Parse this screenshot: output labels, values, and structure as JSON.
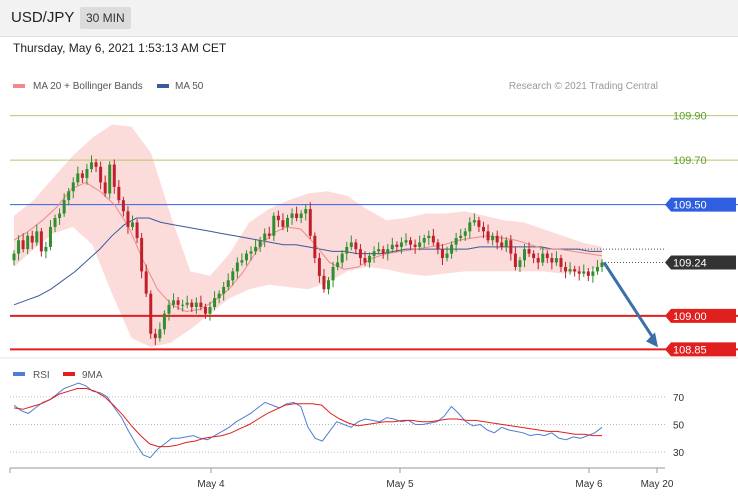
{
  "header": {
    "symbol": "USD/JPY",
    "timeframe": "30 MIN",
    "timestamp": "Thursday, May 6, 2021 1:53:13 AM CET"
  },
  "credit": "Research © 2021 Trading Central",
  "colors": {
    "up_candle": "#2f8f2f",
    "down_candle": "#c0202a",
    "ma20": "#ee8a8a",
    "bands_fill": "#fbd5d5",
    "ma50": "#3a5a9a",
    "support": "#e01f1f",
    "pivot": "#2f5fe0",
    "resistance_thin": "#b8c86a",
    "arrow": "#3b6fa8",
    "rsi": "#4f7fd0",
    "rsi_ma": "#e01f1f"
  },
  "chart_data": [
    {
      "type": "candlestick",
      "title": "USD/JPY",
      "ylim": [
        108.82,
        109.97
      ],
      "x_ticks": [
        "May 4",
        "May 5",
        "May 6",
        "May 20"
      ],
      "legend": [
        {
          "label": "MA 20 + Bollinger Bands",
          "color": "#ee8a8a"
        },
        {
          "label": "MA 50",
          "color": "#3a5a9a"
        }
      ],
      "levels": [
        {
          "value": 109.9,
          "label": "109.90",
          "kind": "resistance",
          "color": "#b8c86a",
          "label_color": "#5aa02a"
        },
        {
          "value": 109.7,
          "label": "109.70",
          "kind": "resistance",
          "color": "#b8c86a",
          "label_color": "#5aa02a"
        },
        {
          "value": 109.5,
          "label": "109.50",
          "kind": "pivot",
          "color": "#2f5fe0",
          "label_color": "#ffffff"
        },
        {
          "value": 109.24,
          "label": "109.24",
          "kind": "last",
          "color": "#333333",
          "label_color": "#ffffff"
        },
        {
          "value": 109.0,
          "label": "109.00",
          "kind": "support",
          "color": "#e01f1f",
          "label_color": "#ffffff"
        },
        {
          "value": 108.85,
          "label": "108.85",
          "kind": "support",
          "color": "#e01f1f",
          "label_color": "#ffffff"
        }
      ],
      "last_price": 109.24,
      "forecast_arrow": {
        "from": 109.24,
        "to": 108.85
      },
      "candles_close": [
        109.28,
        109.34,
        109.3,
        109.36,
        109.33,
        109.38,
        109.29,
        109.31,
        109.4,
        109.44,
        109.46,
        109.52,
        109.56,
        109.6,
        109.64,
        109.62,
        109.66,
        109.69,
        109.67,
        109.6,
        109.55,
        109.68,
        109.58,
        109.52,
        109.47,
        109.4,
        109.42,
        109.35,
        109.2,
        109.1,
        108.92,
        108.9,
        108.94,
        109.01,
        109.05,
        109.07,
        109.05,
        109.05,
        109.06,
        109.04,
        109.06,
        109.04,
        109.01,
        109.04,
        109.08,
        109.1,
        109.13,
        109.16,
        109.2,
        109.24,
        109.25,
        109.28,
        109.29,
        109.31,
        109.34,
        109.37,
        109.36,
        109.45,
        109.43,
        109.4,
        109.44,
        109.46,
        109.44,
        109.46,
        109.48,
        109.36,
        109.26,
        109.18,
        109.12,
        109.16,
        109.22,
        109.24,
        109.28,
        109.31,
        109.33,
        109.3,
        109.26,
        109.24,
        109.27,
        109.29,
        109.3,
        109.28,
        109.3,
        109.32,
        109.31,
        109.33,
        109.34,
        109.32,
        109.31,
        109.33,
        109.35,
        109.36,
        109.33,
        109.3,
        109.26,
        109.28,
        109.32,
        109.35,
        109.36,
        109.38,
        109.42,
        109.43,
        109.4,
        109.38,
        109.34,
        109.36,
        109.33,
        109.31,
        109.34,
        109.28,
        109.22,
        109.25,
        109.3,
        109.28,
        109.26,
        109.24,
        109.28,
        109.26,
        109.24,
        109.26,
        109.22,
        109.2,
        109.21,
        109.2,
        109.19,
        109.2,
        109.18,
        109.2,
        109.22,
        109.24
      ],
      "ma50": [
        109.05,
        109.07,
        109.09,
        109.12,
        109.16,
        109.2,
        109.25,
        109.3,
        109.36,
        109.41,
        109.44,
        109.44,
        109.42,
        109.41,
        109.4,
        109.39,
        109.38,
        109.37,
        109.36,
        109.35,
        109.34,
        109.33,
        109.32,
        109.32,
        109.31,
        109.3,
        109.29,
        109.29,
        109.28,
        109.28,
        109.28,
        109.29,
        109.3,
        109.3,
        109.3,
        109.3,
        109.3,
        109.3,
        109.31,
        109.31,
        109.31,
        109.31,
        109.31,
        109.31,
        109.3,
        109.3,
        109.3,
        109.29,
        109.29
      ],
      "ma20": [
        109.34,
        109.38,
        109.43,
        109.49,
        109.57,
        109.6,
        109.56,
        109.5,
        109.4,
        109.25,
        109.12,
        109.05,
        109.02,
        109.03,
        109.07,
        109.12,
        109.2,
        109.3,
        109.37,
        109.4,
        109.39,
        109.32,
        109.24,
        109.21,
        109.22,
        109.26,
        109.28,
        109.29,
        109.3,
        109.31,
        109.32,
        109.34,
        109.35,
        109.36,
        109.35,
        109.34,
        109.32,
        109.3,
        109.3,
        109.29,
        109.28,
        109.27
      ],
      "band_upper": [
        109.45,
        109.52,
        109.62,
        109.72,
        109.8,
        109.86,
        109.85,
        109.73,
        109.45,
        109.2,
        109.18,
        109.28,
        109.42,
        109.48,
        109.52,
        109.55,
        109.56,
        109.54,
        109.48,
        109.43,
        109.44,
        109.46,
        109.46,
        109.47,
        109.45,
        109.43,
        109.42,
        109.39,
        109.36,
        109.33,
        109.31
      ],
      "band_lower": [
        109.22,
        109.3,
        109.37,
        109.4,
        109.32,
        109.1,
        108.9,
        108.86,
        108.88,
        108.94,
        109.01,
        109.08,
        109.12,
        109.14,
        109.13,
        109.12,
        109.15,
        109.2,
        109.22,
        109.21,
        109.19,
        109.18,
        109.19,
        109.2,
        109.2,
        109.2,
        109.2,
        109.2,
        109.19,
        109.2,
        109.22
      ]
    },
    {
      "type": "line",
      "title": "RSI",
      "ylim": [
        20,
        80
      ],
      "y_ticks": [
        "70",
        "50",
        "30"
      ],
      "x_ticks": [
        "May 4",
        "May 5",
        "May 6",
        "May 20"
      ],
      "legend": [
        {
          "label": "RSI",
          "color": "#4f7fd0"
        },
        {
          "label": "9MA",
          "color": "#e01f1f"
        }
      ],
      "series": [
        {
          "name": "RSI",
          "values": [
            64,
            60,
            58,
            62,
            66,
            68,
            72,
            76,
            78,
            80,
            78,
            74,
            73,
            70,
            62,
            55,
            45,
            36,
            28,
            26,
            32,
            36,
            40,
            40,
            41,
            42,
            40,
            39,
            42,
            45,
            48,
            52,
            55,
            58,
            62,
            66,
            64,
            62,
            65,
            66,
            63,
            48,
            40,
            38,
            45,
            52,
            50,
            48,
            52,
            54,
            53,
            52,
            55,
            54,
            52,
            53,
            50,
            50,
            51,
            52,
            56,
            63,
            58,
            52,
            49,
            50,
            46,
            44,
            48,
            46,
            45,
            44,
            42,
            43,
            42,
            44,
            40,
            39,
            41,
            40,
            42,
            44,
            48
          ]
        },
        {
          "name": "9MA",
          "values": [
            62,
            61,
            63,
            65,
            68,
            72,
            74,
            76,
            76,
            74,
            70,
            64,
            57,
            49,
            42,
            36,
            34,
            34,
            35,
            37,
            38,
            40,
            41,
            42,
            44,
            47,
            50,
            54,
            58,
            61,
            64,
            65,
            65,
            65,
            64,
            58,
            54,
            51,
            49,
            50,
            51,
            52,
            52,
            53,
            53,
            52,
            52,
            53,
            54,
            54,
            53,
            53,
            52,
            51,
            50,
            49,
            48,
            47,
            46,
            45,
            45,
            44,
            43,
            43,
            42,
            42
          ]
        }
      ]
    }
  ]
}
